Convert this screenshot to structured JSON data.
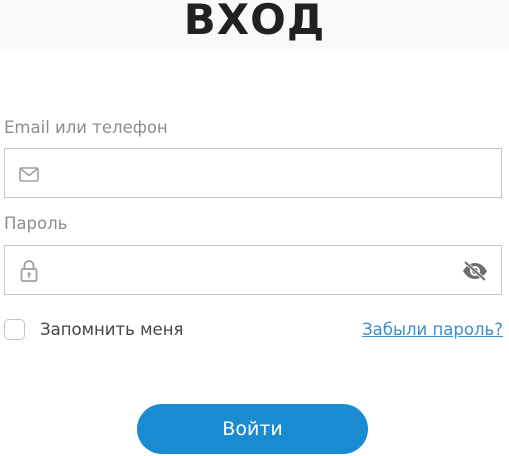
{
  "header": {
    "title": "ВХОД"
  },
  "form": {
    "login_label": "Email или телефон",
    "login_value": "",
    "password_label": "Пароль",
    "password_value": "",
    "remember_label": "Запомнить меня",
    "remember_checked": false,
    "forgot_link": "Забыли пароль?",
    "submit_label": "Войти"
  },
  "icons": {
    "login_field": "envelope-icon",
    "password_field": "lock-icon",
    "password_toggle": "eye-slash-icon"
  },
  "colors": {
    "accent": "#1a8bd0",
    "link": "#3a8fd0",
    "title": "#212121",
    "label": "#8d8d8d",
    "border": "#c6c6c6"
  }
}
